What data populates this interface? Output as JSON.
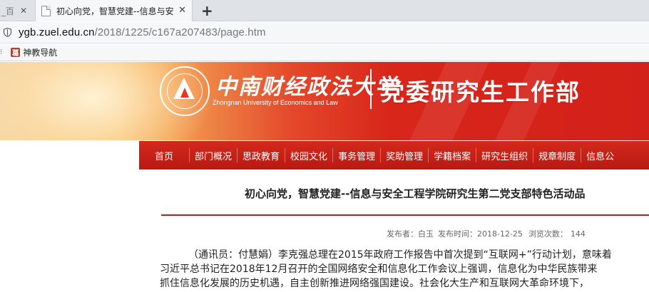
{
  "browser": {
    "tabs": [
      {
        "label": "_百",
        "active": false
      },
      {
        "label": "初心向党，智慧党建--信息与安",
        "active": true
      }
    ],
    "new_tab_label": "+",
    "url_host": "ygb.zuel.edu.cn",
    "url_path": "/2018/1225/c167a207483/page.htm",
    "bookmarks": [
      {
        "label": "神教导航",
        "icon": "bookmark-favicon"
      }
    ]
  },
  "header": {
    "school_name_cn": "中南财经政法大学",
    "school_name_en": "Zhongnan University of Economics and Law",
    "department": "党委研究生工作部"
  },
  "nav": {
    "items": [
      "首页",
      "部门概况",
      "思政教育",
      "校园文化",
      "事务管理",
      "奖助管理",
      "学籍档案",
      "研究生组织",
      "规章制度",
      "信息公"
    ]
  },
  "article": {
    "title": "初心向党，智慧党建--信息与安全工程学院研究生第二党支部特色活动品",
    "publisher_label": "发布者：白玉",
    "date_label": "发布时间：2018-12-25",
    "views_label": "浏览次数：",
    "views": "144",
    "paragraph_lines": [
      "（通讯员：付慧娟）李克强总理在2015年政府工作报告中首次提到“互联网+”行动计划，意味着",
      "习近平总书记在2018年12月召开的全国网络安全和信息化工作会议上强调，信息化为中华民族带来",
      "抓住信息化发展的历史机遇，自主创新推进网络强国建设。社会化大生产和互联网大革命环境下，"
    ]
  },
  "colors": {
    "accent": "#d32119",
    "nav_bg": "#c42016"
  }
}
